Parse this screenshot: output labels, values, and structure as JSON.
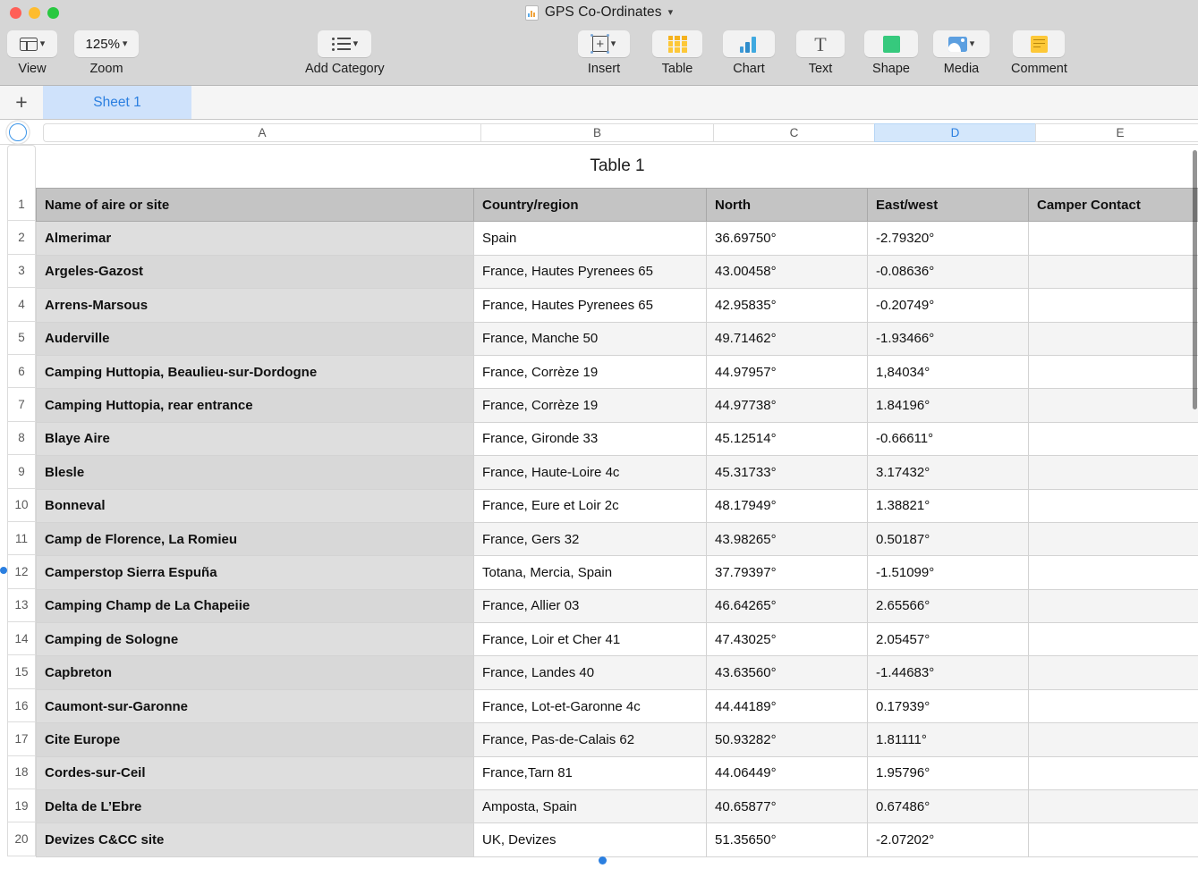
{
  "window": {
    "title": "GPS Co-Ordinates",
    "doc_icon": "numbers-doc-icon",
    "title_chevron": "chevron-down-icon",
    "traffic_lights": [
      {
        "name": "close-button",
        "color": "#ff5f57"
      },
      {
        "name": "minimize-button",
        "color": "#febc2e"
      },
      {
        "name": "maximize-button",
        "color": "#28c840"
      }
    ]
  },
  "toolbar": {
    "view": {
      "label": "View",
      "icon": "view-panel-icon",
      "chevron": "chevron-down-icon"
    },
    "zoom": {
      "label": "Zoom",
      "value": "125%",
      "chevron": "chevron-down-icon"
    },
    "add_category": {
      "label": "Add Category",
      "icon": "list-bullet-icon",
      "chevron": "chevron-down-icon"
    },
    "insert": {
      "label": "Insert",
      "icon": "insert-plus-icon",
      "chevron": "chevron-down-icon"
    },
    "table": {
      "label": "Table",
      "icon": "table-icon"
    },
    "chart": {
      "label": "Chart",
      "icon": "bar-chart-icon"
    },
    "text": {
      "label": "Text",
      "icon": "text-t-icon",
      "glyph": "T"
    },
    "shape": {
      "label": "Shape",
      "icon": "shape-square-icon"
    },
    "media": {
      "label": "Media",
      "icon": "media-image-icon",
      "chevron": "chevron-down-icon"
    },
    "comment": {
      "label": "Comment",
      "icon": "comment-note-icon"
    }
  },
  "sheetbar": {
    "add_sheet_label": "+",
    "tabs": [
      {
        "label": "Sheet 1",
        "active": true
      }
    ]
  },
  "column_headers": {
    "selection_corner_icon": "select-all-circle-icon",
    "columns": [
      {
        "label": "A",
        "selected": false
      },
      {
        "label": "B",
        "selected": false
      },
      {
        "label": "C",
        "selected": false
      },
      {
        "label": "D",
        "selected": true
      },
      {
        "label": "E",
        "selected": false
      }
    ]
  },
  "table": {
    "title": "Table 1",
    "headers": [
      "Name of aire or site",
      "Country/region",
      "North",
      "East/west",
      "Camper Contact"
    ],
    "row_numbers": [
      "1",
      "2",
      "3",
      "4",
      "5",
      "6",
      "7",
      "8",
      "9",
      "10",
      "11",
      "12",
      "13",
      "14",
      "15",
      "16",
      "17",
      "18",
      "19",
      "20"
    ],
    "rows": [
      {
        "name": "Almerimar",
        "region": "Spain",
        "north": "36.69750°",
        "east": "-2.79320°",
        "contact": ""
      },
      {
        "name": "Argeles-Gazost",
        "region": "France, Hautes  Pyrenees 65",
        "north": "43.00458°",
        "east": "-0.08636°",
        "contact": ""
      },
      {
        "name": "Arrens-Marsous",
        "region": "France, Hautes Pyrenees 65",
        "north": "42.95835°",
        "east": "-0.20749°",
        "contact": ""
      },
      {
        "name": "Auderville",
        "region": "France, Manche 50",
        "north": "49.71462°",
        "east": "-1.93466°",
        "contact": ""
      },
      {
        "name": "Camping Huttopia, Beaulieu-sur-Dordogne",
        "region": "France, Corrèze 19",
        "north": "44.97957°",
        "east": "1,84034°",
        "contact": ""
      },
      {
        "name": "Camping Huttopia, rear entrance",
        "region": "France, Corrèze 19",
        "north": "44.97738°",
        "east": "1.84196°",
        "contact": ""
      },
      {
        "name": "Blaye Aire",
        "region": "France, Gironde 33",
        "north": "45.12514°",
        "east": "-0.66611°",
        "contact": ""
      },
      {
        "name": "Blesle",
        "region": "France, Haute-Loire 4c",
        "north": "45.31733°",
        "east": "3.17432°",
        "contact": ""
      },
      {
        "name": "Bonneval",
        "region": "France, Eure et Loir 2c",
        "north": "48.17949°",
        "east": "1.38821°",
        "contact": ""
      },
      {
        "name": "Camp de Florence, La Romieu",
        "region": "France, Gers 32",
        "north": "43.98265°",
        "east": "0.50187°",
        "contact": ""
      },
      {
        "name": "Camperstop Sierra Espuña",
        "region": "Totana, Mercia, Spain",
        "north": "37.79397°",
        "east": "-1.51099°",
        "contact": ""
      },
      {
        "name": "Camping Champ de La Chapeiie",
        "region": "France, Allier 03",
        "north": "46.64265°",
        "east": "2.65566°",
        "contact": ""
      },
      {
        "name": "Camping de Sologne",
        "region": "France, Loir et Cher 41",
        "north": "47.43025°",
        "east": "2.05457°",
        "contact": ""
      },
      {
        "name": "Capbreton",
        "region": "France, Landes 40",
        "north": "43.63560°",
        "east": "-1.44683°",
        "contact": ""
      },
      {
        "name": "Caumont-sur-Garonne",
        "region": "France, Lot-et-Garonne 4c",
        "north": "44.44189°",
        "east": "0.17939°",
        "contact": ""
      },
      {
        "name": "Cite Europe",
        "region": "France, Pas-de-Calais 62",
        "north": "50.93282°",
        "east": "1.81111°",
        "contact": ""
      },
      {
        "name": "Cordes-sur-Ceil",
        "region": "France,Tarn 81",
        "north": "44.06449°",
        "east": "1.95796°",
        "contact": ""
      },
      {
        "name": "Delta de L’Ebre",
        "region": "Amposta, Spain",
        "north": "40.65877°",
        "east": "0.67486°",
        "contact": ""
      },
      {
        "name": "Devizes C&CC site",
        "region": "UK, Devizes",
        "north": "51.35650°",
        "east": "-2.07202°",
        "contact": ""
      }
    ]
  },
  "colors": {
    "accent": "#2b7fe0",
    "header_fill": "#c4c4c4",
    "name_col_fill": "#dedede",
    "chrome": "#d6d6d6"
  }
}
